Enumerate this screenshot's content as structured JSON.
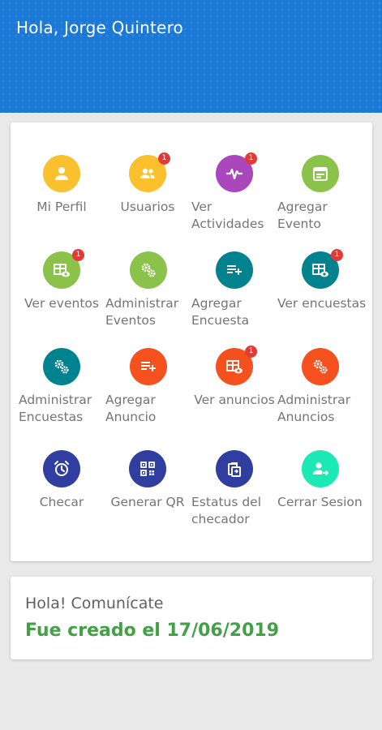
{
  "header": {
    "greeting": "Hola, Jorge Quintero"
  },
  "colors": {
    "header_blue": "#1a78d6",
    "yellow": "#fbc02d",
    "purple": "#ab47bc",
    "light_green": "#8bc34a",
    "teal": "#00838f",
    "orange_red": "#f4511e",
    "indigo": "#303f9f",
    "mint": "#1de9b6",
    "badge_red": "#e53935",
    "accent_green": "#43a047"
  },
  "menu": {
    "items": [
      {
        "label": "Mi Perfil",
        "icon": "person-icon",
        "badge": ""
      },
      {
        "label": "Usuarios",
        "icon": "group-icon",
        "badge": "1"
      },
      {
        "label": "Ver Actividades",
        "icon": "activity-pulse-icon",
        "badge": "1"
      },
      {
        "label": "Agregar Evento",
        "icon": "calendar-icon",
        "badge": ""
      },
      {
        "label": "Ver eventos",
        "icon": "view-table-icon",
        "badge": "1"
      },
      {
        "label": "Administrar Eventos",
        "icon": "gears-icon",
        "badge": ""
      },
      {
        "label": "Agregar Encuesta",
        "icon": "playlist-add-icon",
        "badge": ""
      },
      {
        "label": "Ver encuestas",
        "icon": "view-table-icon",
        "badge": "1"
      },
      {
        "label": "Administrar Encuestas",
        "icon": "gears-icon",
        "badge": ""
      },
      {
        "label": "Agregar Anuncio",
        "icon": "playlist-add-icon",
        "badge": ""
      },
      {
        "label": "Ver anuncios",
        "icon": "view-table-icon",
        "badge": "1"
      },
      {
        "label": "Administrar Anuncios",
        "icon": "gears-icon",
        "badge": ""
      },
      {
        "label": "Checar",
        "icon": "alarm-clock-icon",
        "badge": ""
      },
      {
        "label": "Generar QR",
        "icon": "qr-code-icon",
        "badge": ""
      },
      {
        "label": "Estatus del checador",
        "icon": "copy-documents-icon",
        "badge": ""
      },
      {
        "label": "Cerrar Sesion",
        "icon": "person-logout-icon",
        "badge": ""
      }
    ]
  },
  "info": {
    "title": "Hola! Comunícate",
    "created": "Fue creado el 17/06/2019"
  }
}
